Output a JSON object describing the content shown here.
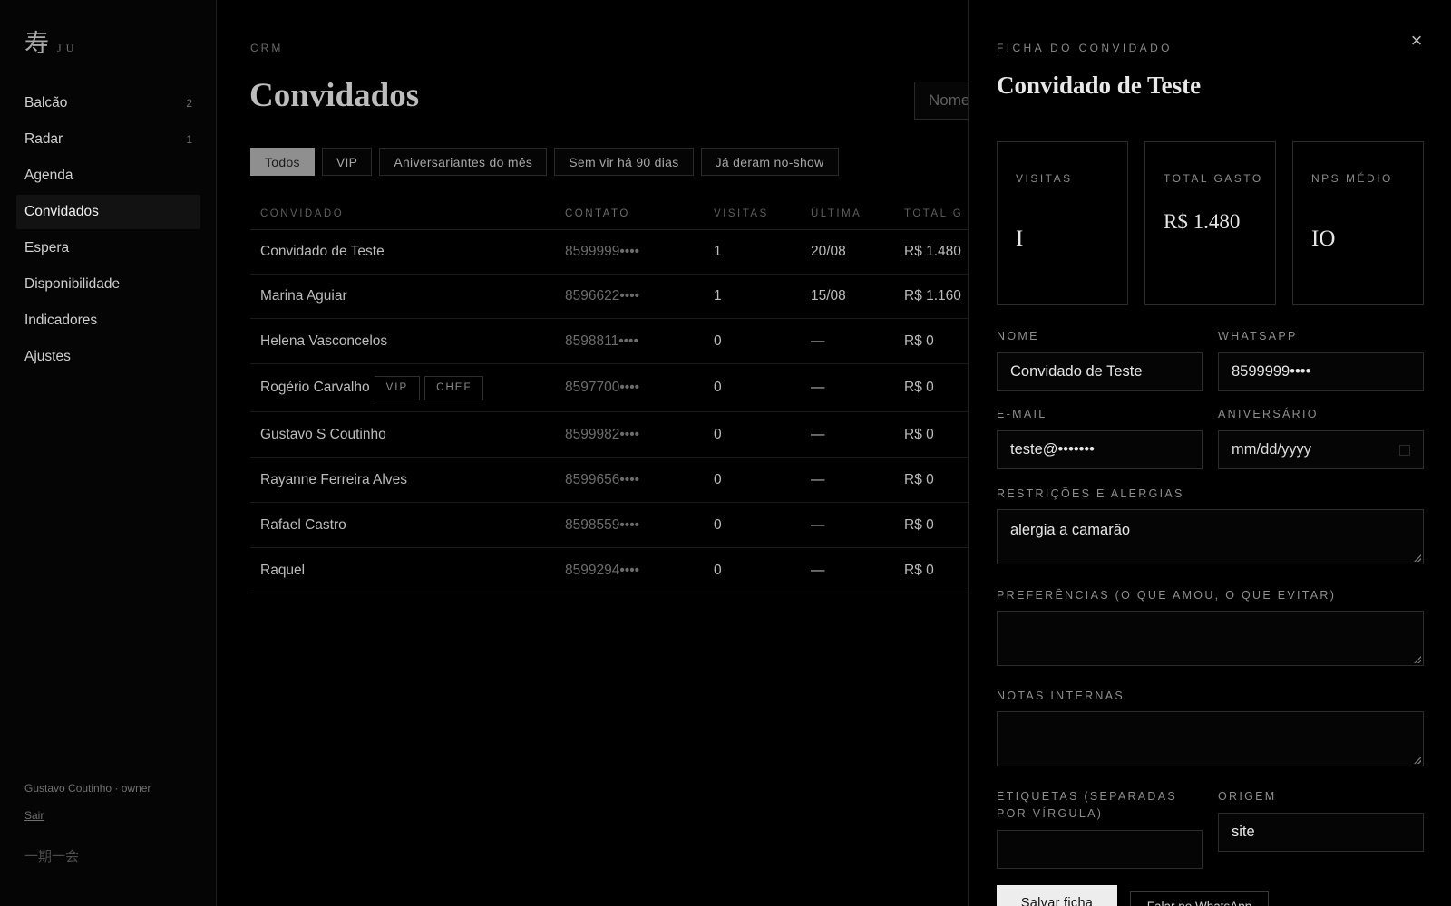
{
  "brand": {
    "kanji": "寿",
    "text": "JU"
  },
  "sidebar": {
    "items": [
      {
        "label": "Balcão",
        "count": "2"
      },
      {
        "label": "Radar",
        "count": "1"
      },
      {
        "label": "Agenda",
        "count": ""
      },
      {
        "label": "Convidados",
        "count": "",
        "active": true
      },
      {
        "label": "Espera",
        "count": ""
      },
      {
        "label": "Disponibilidade",
        "count": ""
      },
      {
        "label": "Indicadores",
        "count": ""
      },
      {
        "label": "Ajustes",
        "count": ""
      }
    ],
    "user": "Gustavo Coutinho · owner",
    "logout": "Sair",
    "motto": "一期一会"
  },
  "main": {
    "eyebrow": "CRM",
    "title": "Convidados",
    "search_placeholder": "Nome",
    "filters": [
      "Todos",
      "VIP",
      "Aniversariantes do mês",
      "Sem vir há 90 dias",
      "Já deram no-show"
    ],
    "active_filter": "Todos",
    "columns": [
      "CONVIDADO",
      "CONTATO",
      "VISITAS",
      "ÚLTIMA",
      "TOTAL G"
    ],
    "rows": [
      {
        "name": "Convidado de Teste",
        "tags": [],
        "contact": "8599999••••",
        "visits": "1",
        "last": "20/08",
        "total": "R$ 1.480"
      },
      {
        "name": "Marina Aguiar",
        "tags": [],
        "contact": "8596622••••",
        "visits": "1",
        "last": "15/08",
        "total": "R$ 1.160"
      },
      {
        "name": "Helena Vasconcelos",
        "tags": [],
        "contact": "8598811••••",
        "visits": "0",
        "last": "—",
        "total": "R$ 0"
      },
      {
        "name": "Rogério Carvalho",
        "tags": [
          "VIP",
          "CHEF"
        ],
        "contact": "8597700••••",
        "visits": "0",
        "last": "—",
        "total": "R$ 0"
      },
      {
        "name": "Gustavo S Coutinho",
        "tags": [],
        "contact": "8599982••••",
        "visits": "0",
        "last": "—",
        "total": "R$ 0"
      },
      {
        "name": "Rayanne Ferreira Alves",
        "tags": [],
        "contact": "8599656••••",
        "visits": "0",
        "last": "—",
        "total": "R$ 0"
      },
      {
        "name": "Rafael Castro",
        "tags": [],
        "contact": "8598559••••",
        "visits": "0",
        "last": "—",
        "total": "R$ 0"
      },
      {
        "name": "Raquel",
        "tags": [],
        "contact": "8599294••••",
        "visits": "0",
        "last": "—",
        "total": "R$ 0"
      }
    ]
  },
  "drawer": {
    "eyebrow": "FICHA DO CONVIDADO",
    "title": "Convidado de Teste",
    "close_icon": "×",
    "stats": [
      {
        "label": "VISITAS",
        "value": "I"
      },
      {
        "label": "TOTAL GASTO",
        "value": "R$ 1.480"
      },
      {
        "label": "NPS MÉDIO",
        "value": "IO"
      }
    ],
    "fields": {
      "nome_label": "NOME",
      "nome_value": "Convidado de Teste",
      "whatsapp_label": "WHATSAPP",
      "whatsapp_value": "8599999••••",
      "email_label": "E-MAIL",
      "email_value": "teste@•••••••",
      "aniversario_label": "ANIVERSÁRIO",
      "aniversario_value": "mm/dd/yyyy",
      "restricoes_label": "RESTRIÇÕES E ALERGIAS",
      "restricoes_value": "alergia a camarão",
      "preferencias_label": "PREFERÊNCIAS (O QUE AMOU, O QUE EVITAR)",
      "preferencias_value": "",
      "notas_label": "NOTAS INTERNAS",
      "notas_value": "",
      "etiquetas_label_1": "ETIQUETAS (SEPARADAS",
      "etiquetas_label_2": "POR VÍRGULA)",
      "etiquetas_value": "",
      "origem_label": "ORIGEM",
      "origem_value": "site"
    },
    "save_label": "Salvar ficha",
    "whatsapp_button_label": "Falar no WhatsApp"
  }
}
